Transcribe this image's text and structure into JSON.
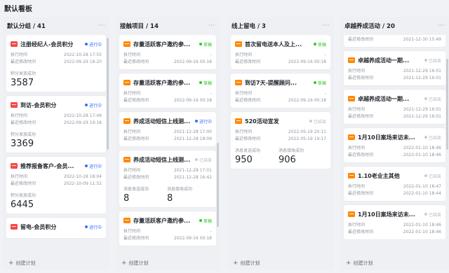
{
  "page_title": "默认看板",
  "colors": {
    "accent": "#3370ff",
    "green": "#34c724",
    "red_icon": "#f54a45",
    "orange_icon": "#ff8800"
  },
  "create_label": "创建计划",
  "more_icon": "ellipsis-icon",
  "columns": [
    {
      "title": "默认分组 / 41",
      "cards": [
        {
          "icon": "red",
          "title": "注册经纪人-会员积分",
          "status": "进行中",
          "status_color": "blue",
          "rows": [
            {
              "label": "执行时间",
              "value": "2022-10-28 17:55"
            },
            {
              "label": "最近修改时间",
              "value": "2022-09-29 18:20"
            }
          ],
          "metrics": [
            {
              "label": "积分发放成功",
              "value": "3587"
            }
          ]
        },
        {
          "icon": "red",
          "title": "到访-会员积分",
          "status": "进行中",
          "status_color": "blue",
          "rows": [
            {
              "label": "执行时间",
              "value": "2022-10-28 17:49"
            },
            {
              "label": "最近修改时间",
              "value": "2022-09-29 19:18"
            }
          ],
          "metrics": [
            {
              "label": "积分发放成功",
              "value": "3369"
            }
          ]
        },
        {
          "icon": "red",
          "title": "推荐报备客户-会员...",
          "status": "进行中",
          "status_color": "blue",
          "rows": [
            {
              "label": "执行时间",
              "value": "2022-10-28 18:04"
            },
            {
              "label": "最近修改时间",
              "value": "2022-10-09 11:52"
            }
          ],
          "metrics": [
            {
              "label": "积分发放成功",
              "value": "6445"
            }
          ]
        },
        {
          "icon": "red",
          "title": "留电-会员积分",
          "status": "进行中",
          "status_color": "blue",
          "rows": [],
          "metrics": []
        }
      ]
    },
    {
      "title": "接触项目 / 14",
      "cards": [
        {
          "icon": "orange",
          "title": "存量活跃客户邀约参...",
          "status": "草稿",
          "status_color": "green",
          "rows": [
            {
              "label": "执行时间",
              "value": "-"
            },
            {
              "label": "最近修改时间",
              "value": "2022-09-16 00:18"
            }
          ],
          "metrics": []
        },
        {
          "icon": "orange",
          "title": "存量活跃客户邀约参...",
          "status": "草稿",
          "status_color": "green",
          "rows": [
            {
              "label": "执行时间",
              "value": "-"
            },
            {
              "label": "最近修改时间",
              "value": "2022-09-16 00:18"
            }
          ],
          "metrics": []
        },
        {
          "icon": "orange",
          "title": "养成活动短信上线测...",
          "status": "进行中",
          "status_color": "blue",
          "rows": [
            {
              "label": "执行时间",
              "value": "2021-12-28 17:00"
            },
            {
              "label": "最近修改时间",
              "value": "2021-12-28 18:09"
            }
          ],
          "metrics": []
        },
        {
          "icon": "orange",
          "title": "养成活动短信上线测...",
          "status": "已结束",
          "status_color": "gray",
          "rows": [
            {
              "label": "执行时间",
              "value": "2021-12-28 17:01"
            },
            {
              "label": "最近修改时间",
              "value": "2021-12-28 16:42"
            }
          ],
          "metrics": [
            {
              "label": "消息发送成功",
              "value": "8"
            },
            {
              "label": "消息接收成功",
              "value": "8"
            }
          ]
        },
        {
          "icon": "orange",
          "title": "存量活跃客户邀约参...",
          "status": "草稿",
          "status_color": "green",
          "rows": [
            {
              "label": "执行时间",
              "value": "-"
            },
            {
              "label": "最近修改时间",
              "value": "2022-09-16 00:18"
            }
          ],
          "metrics": []
        }
      ]
    },
    {
      "title": "线上留电 / 3",
      "cards": [
        {
          "icon": "orange",
          "title": "首次留电送本人及上...",
          "status": "草稿",
          "status_color": "green",
          "rows": [
            {
              "label": "执行时间",
              "value": "-"
            },
            {
              "label": "最近修改时间",
              "value": "2022-09-16 00:18"
            }
          ],
          "metrics": []
        },
        {
          "icon": "orange",
          "title": "到访7天-提醒顾问...",
          "status": "草稿",
          "status_color": "green",
          "rows": [
            {
              "label": "执行时间",
              "value": "-"
            },
            {
              "label": "最近修改时间",
              "value": "2022-09-16 00:18"
            }
          ],
          "metrics": []
        },
        {
          "icon": "orange",
          "title": "520活动宣发",
          "status": "已结束",
          "status_color": "gray",
          "rows": [
            {
              "label": "执行时间",
              "value": "2022-05-19 20:11"
            },
            {
              "label": "最近修改时间",
              "value": "2022-05-19 19:17"
            }
          ],
          "metrics": [
            {
              "label": "消息发送成功",
              "value": "950"
            },
            {
              "label": "消息接收成功",
              "value": "906"
            }
          ]
        }
      ]
    },
    {
      "title": "卓越养成活动 / 20",
      "cards": [
        {
          "icon": "orange",
          "title": "",
          "status": "",
          "status_color": "gray",
          "rows": [
            {
              "label": "执行时间",
              "value": "2021-12-30 15:30"
            },
            {
              "label": "最近修改时间",
              "value": "2021-12-30 15:49"
            }
          ],
          "metrics": []
        },
        {
          "icon": "orange",
          "title": "卓越养成活动一期...",
          "status": "已结束",
          "status_color": "gray",
          "rows": [
            {
              "label": "执行时间",
              "value": "2021-12-29 16:01"
            },
            {
              "label": "最近修改时间",
              "value": "2021-12-29 16:01"
            }
          ],
          "metrics": []
        },
        {
          "icon": "orange",
          "title": "卓越养成活动一期...",
          "status": "已结束",
          "status_color": "gray",
          "rows": [
            {
              "label": "执行时间",
              "value": "2021-12-29 16:01"
            },
            {
              "label": "最近修改时间",
              "value": "2021-12-29 16:01"
            }
          ],
          "metrics": []
        },
        {
          "icon": "orange",
          "title": "1月10日案场来访未...",
          "status": "已结束",
          "status_color": "gray",
          "rows": [
            {
              "label": "执行时间",
              "value": "2022-01-10 18:46"
            },
            {
              "label": "最近修改时间",
              "value": "2022-01-10 18:46"
            }
          ],
          "metrics": []
        },
        {
          "icon": "orange",
          "title": "1.10老业主其他",
          "status": "已结束",
          "status_color": "gray",
          "rows": [
            {
              "label": "执行时间",
              "value": "2022-01-10 18:47"
            },
            {
              "label": "最近修改时间",
              "value": "2022-01-10 18:44"
            }
          ],
          "metrics": []
        },
        {
          "icon": "orange",
          "title": "1月10日案场来访未...",
          "status": "已结束",
          "status_color": "gray",
          "rows": [
            {
              "label": "执行时间",
              "value": "2022-01-10 18:46"
            },
            {
              "label": "最近修改时间",
              "value": "2022-01-10 18:46"
            }
          ],
          "metrics": []
        }
      ]
    }
  ]
}
